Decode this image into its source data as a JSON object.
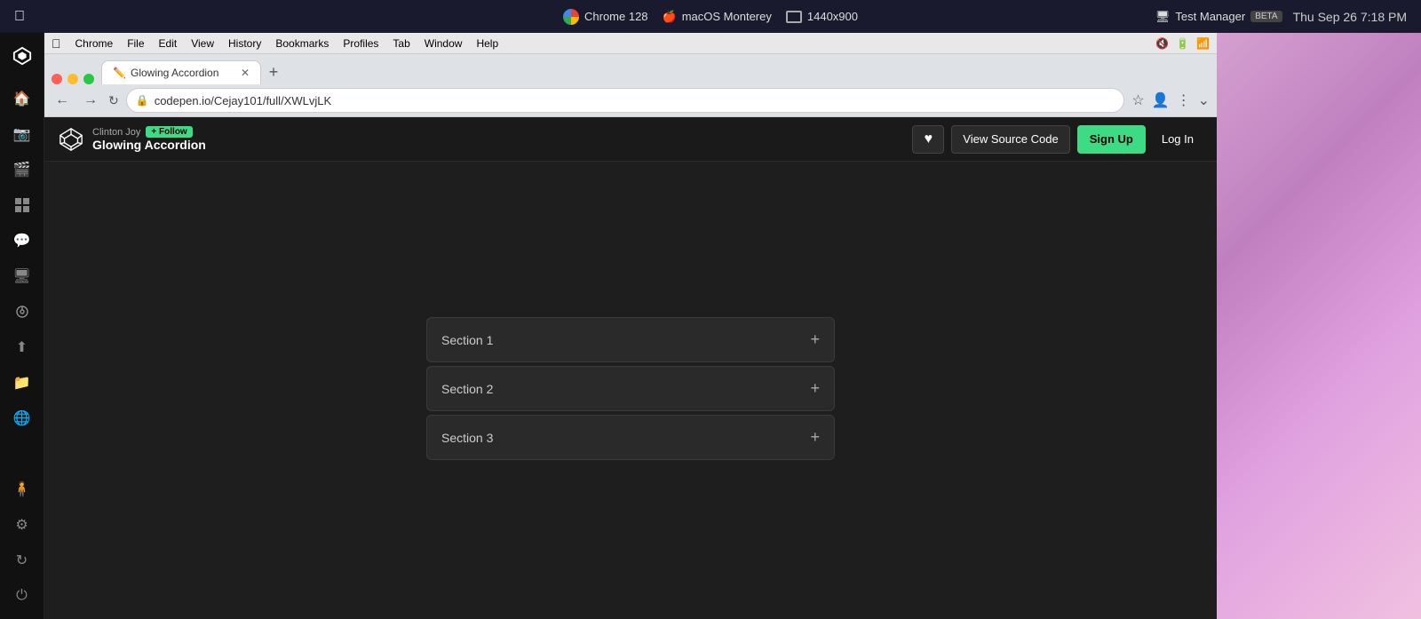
{
  "os": {
    "topbar": {
      "chrome_label": "Chrome 128",
      "macos_label": "macOS Monterey",
      "resolution_label": "1440x900",
      "test_manager_label": "Test Manager",
      "beta_label": "BETA",
      "time": "Thu Sep 26  7:18 PM"
    },
    "menubar": {
      "apple": "&#63743;",
      "items": [
        "Chrome",
        "File",
        "Edit",
        "View",
        "History",
        "Bookmarks",
        "Profiles",
        "Tab",
        "Window",
        "Help"
      ]
    }
  },
  "browser": {
    "tab": {
      "title": "Glowing Accordion",
      "favicon": "✏️"
    },
    "url": "codepen.io/Cejay101/full/XWLvjLK",
    "new_tab_label": "+"
  },
  "codepen": {
    "logo_unicode": "⬡",
    "author": "Clinton Joy",
    "follow_label": "+ Follow",
    "pen_title": "Glowing Accordion",
    "heart_label": "♥",
    "view_source_label": "View Source Code",
    "signup_label": "Sign Up",
    "login_label": "Log In",
    "accordion": {
      "sections": [
        {
          "label": "Section 1"
        },
        {
          "label": "Section 2"
        },
        {
          "label": "Section 3"
        }
      ],
      "expand_icon": "+"
    }
  },
  "sidebar": {
    "icons": [
      {
        "name": "home-icon",
        "glyph": "⊞",
        "label": "Home"
      },
      {
        "name": "camera-icon",
        "glyph": "📷",
        "label": "Camera"
      },
      {
        "name": "video-icon",
        "glyph": "🎬",
        "label": "Video"
      },
      {
        "name": "grid-icon",
        "glyph": "⊞",
        "label": "Grid"
      },
      {
        "name": "chat-icon",
        "glyph": "💬",
        "label": "Chat"
      },
      {
        "name": "monitor-icon",
        "glyph": "🖥",
        "label": "Monitor"
      },
      {
        "name": "network-icon",
        "glyph": "◉",
        "label": "Network"
      },
      {
        "name": "upload-icon",
        "glyph": "⬆",
        "label": "Upload"
      },
      {
        "name": "folder-icon",
        "glyph": "📁",
        "label": "Folder"
      },
      {
        "name": "globe-icon",
        "glyph": "🌐",
        "label": "Globe"
      },
      {
        "name": "person-icon",
        "glyph": "🧍",
        "label": "Person"
      },
      {
        "name": "settings-icon",
        "glyph": "⚙",
        "label": "Settings"
      },
      {
        "name": "refresh-icon",
        "glyph": "↻",
        "label": "Refresh"
      },
      {
        "name": "power-icon",
        "glyph": "⏻",
        "label": "Power"
      }
    ]
  }
}
